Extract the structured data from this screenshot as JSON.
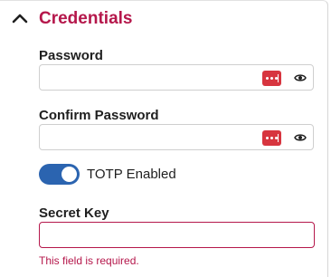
{
  "section": {
    "title": "Credentials",
    "expanded": true,
    "accent_color": "#b5174b"
  },
  "fields": {
    "password": {
      "label": "Password",
      "value": "",
      "placeholder": ""
    },
    "confirm_password": {
      "label": "Confirm Password",
      "value": "",
      "placeholder": ""
    },
    "totp": {
      "label": "TOTP Enabled",
      "enabled": true,
      "toggle_color": "#2b64b0"
    },
    "secret_key": {
      "label": "Secret Key",
      "value": "",
      "placeholder": "",
      "error": "This field is required."
    }
  },
  "icons": {
    "collapse": "chevron-up-icon",
    "password_manager": "password-manager-icon",
    "reveal": "eye-icon"
  },
  "colors": {
    "password_manager_icon": "#d7353f"
  }
}
